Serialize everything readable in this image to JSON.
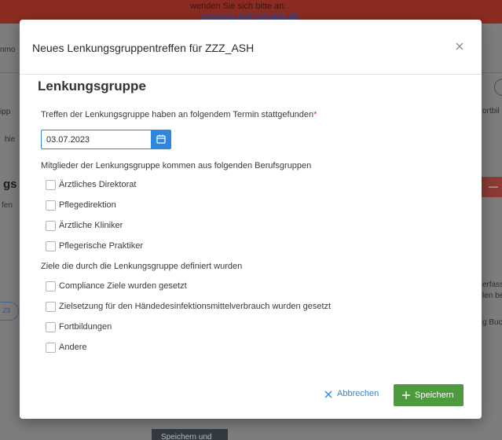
{
  "background": {
    "notice_line": "wenden Sie sich bitte an:",
    "notice_link": "webkess-test@charite.de",
    "left_snippets": [
      "nmo",
      "ipp",
      "hie",
      "gs",
      "fen"
    ],
    "right_snippets": [
      "ortbil",
      "erfass",
      "len be",
      "g Buc"
    ],
    "pill_text": "23",
    "bottom_button": "Speichern und"
  },
  "modal": {
    "title": "Neues Lenkungsgruppentreffen für ZZZ_ASH",
    "close_label": "×",
    "section_title": "Lenkungsgruppe",
    "date_label": "Treffen der Lenkungsgruppe haben an folgendem Termin stattgefunden",
    "required_marker": "*",
    "date_value": "03.07.2023",
    "groups_label": "Mitglieder der Lenkungsgruppe kommen aus folgenden Berufsgruppen",
    "groups": [
      {
        "label": "Ärztliches Direktorat",
        "checked": false
      },
      {
        "label": "Pflegedirektion",
        "checked": false
      },
      {
        "label": "Ärztliche Kliniker",
        "checked": false
      },
      {
        "label": "Pflegerische Praktiker",
        "checked": false
      }
    ],
    "goals_label": "Ziele die durch die Lenkungsgruppe definiert wurden",
    "goals": [
      {
        "label": "Compliance Ziele wurden gesetzt",
        "checked": false
      },
      {
        "label": "Zielsetzung für den Händedesinfektionsmittelverbrauch wurden gesetzt",
        "checked": false
      },
      {
        "label": "Fortbildungen",
        "checked": false
      },
      {
        "label": "Andere",
        "checked": false
      }
    ],
    "cancel_label": "Abbrechen",
    "save_label": "Speichern"
  },
  "colors": {
    "accent_blue": "#2e86de",
    "save_green": "#4e9a3e",
    "required_red": "#d8342a",
    "top_bar_red": "#8b2c22"
  },
  "icons": {
    "close": "close-icon",
    "calendar": "calendar-icon",
    "cancel": "x-icon",
    "save": "plus-icon"
  }
}
